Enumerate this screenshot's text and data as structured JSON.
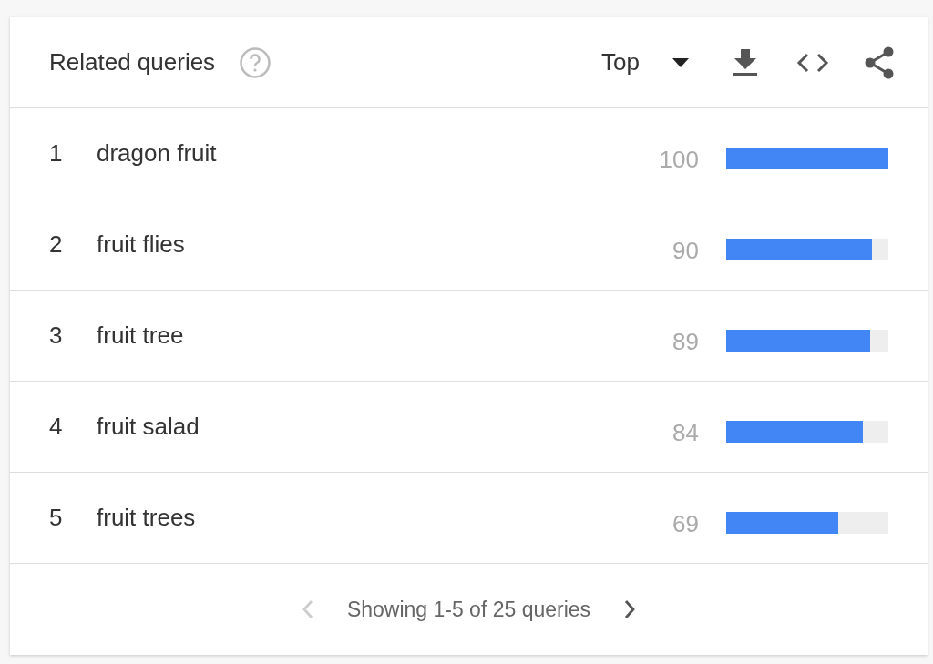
{
  "header": {
    "title": "Related queries",
    "filter": "Top"
  },
  "rows": [
    {
      "rank": "1",
      "query": "dragon fruit",
      "value": "100",
      "level": 1
    },
    {
      "rank": "2",
      "query": "fruit flies",
      "value": "90",
      "level": 0.9
    },
    {
      "rank": "3",
      "query": "fruit tree",
      "value": "89",
      "level": 0.89
    },
    {
      "rank": "4",
      "query": "fruit salad",
      "value": "84",
      "level": 0.84
    },
    {
      "rank": "5",
      "query": "fruit trees",
      "value": "69",
      "level": 0.69
    }
  ],
  "footer": {
    "text": "Showing 1-5 of 25 queries",
    "previous": {
      "disabled": true
    },
    "next": {
      "disabled": false
    }
  }
}
